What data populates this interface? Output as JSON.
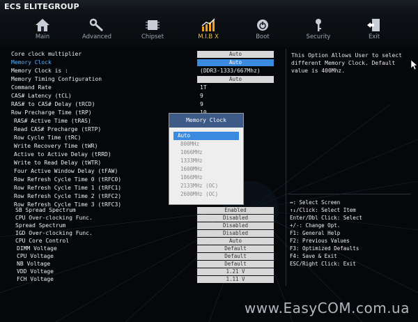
{
  "brand": {
    "logo_text": "ECS ELITEGROUP"
  },
  "tabs": [
    {
      "label": "Main",
      "icon": "home-icon",
      "active": false
    },
    {
      "label": "Advanced",
      "icon": "wrench-icon",
      "active": false
    },
    {
      "label": "Chipset",
      "icon": "chip-icon",
      "active": false
    },
    {
      "label": "M.I.B X",
      "icon": "chart-icon",
      "active": true
    },
    {
      "label": "Boot",
      "icon": "power-icon",
      "active": false
    },
    {
      "label": "Security",
      "icon": "key-icon",
      "active": false
    },
    {
      "label": "Exit",
      "icon": "exit-door-icon",
      "active": false
    }
  ],
  "settings": [
    {
      "label": "Core clock multiplier",
      "value": "Auto",
      "kind": "box"
    },
    {
      "label": "Memory Clock",
      "value": "Auto",
      "kind": "box-active",
      "selected": true
    },
    {
      "label": "Memory Clock is :",
      "value": "(DDR3-1333/667Mhz)",
      "kind": "text"
    },
    {
      "label": "Memory Timing Configuration",
      "value": "Auto",
      "kind": "box"
    },
    {
      "label": "Command Rate",
      "value": "1T",
      "kind": "text"
    },
    {
      "label": "CAS# Latency (tCL)",
      "value": "9",
      "kind": "text"
    },
    {
      "label": "RAS# to CAS# Delay (tRCD)",
      "value": "9",
      "kind": "text"
    },
    {
      "label": "Row Precharge Time (tRP)",
      "value": "10",
      "kind": "text"
    },
    {
      "label": "RAS# Active Time (tRAS)",
      "value": "",
      "kind": "text"
    },
    {
      "label": "Read CAS# Precharge (tRTP)",
      "value": "",
      "kind": "text"
    },
    {
      "label": "Row Cycle Time (tRC)",
      "value": "",
      "kind": "text"
    },
    {
      "label": "Write Recovery Time (tWR)",
      "value": "",
      "kind": "text"
    },
    {
      "label": "Active to Active Delay (tRRD)",
      "value": "",
      "kind": "text"
    },
    {
      "label": "Write to Read Delay (tWTR)",
      "value": "",
      "kind": "text"
    },
    {
      "label": "Four Active Window Delay (tFAW)",
      "value": "",
      "kind": "text"
    },
    {
      "label": "Row Refresh Cycle Time 0 (tRFC0)",
      "value": "",
      "kind": "text"
    },
    {
      "label": "Row Refresh Cycle Time 1 (tRFC1)",
      "value": "",
      "kind": "text"
    },
    {
      "label": "Row Refresh Cycle Time 2 (tRFC2)",
      "value": "",
      "kind": "text"
    },
    {
      "label": "Row Refresh Cycle Time 3 (tRFC3)",
      "value": "",
      "kind": "text"
    },
    {
      "label": "SB Spread Spectrum",
      "value": "Enabled",
      "kind": "box"
    },
    {
      "label": "CPU Over-clocking Func.",
      "value": "Disabled",
      "kind": "box"
    },
    {
      "label": "Spread Spectrum",
      "value": "Disabled",
      "kind": "box"
    },
    {
      "label": "IGD Over-clocking Func.",
      "value": "Disabled",
      "kind": "box"
    },
    {
      "label": "CPU Core Control",
      "value": "Auto",
      "kind": "box"
    },
    {
      "label": "DIMM Voltage",
      "value": "Default",
      "kind": "box"
    },
    {
      "label": "CPU Voltage",
      "value": "Default",
      "kind": "box"
    },
    {
      "label": "NB Voltage",
      "value": "Default",
      "kind": "box"
    },
    {
      "label": "VDD Voltage",
      "value": "1.21 V",
      "kind": "box"
    },
    {
      "label": "FCH Voltage",
      "value": "1.11 V",
      "kind": "box"
    }
  ],
  "help_text": "This Option Allows User to select different Memory Clock. Default value is 400Mhz.",
  "key_help": [
    "↔: Select Screen",
    "↑↓/Click: Select Item",
    "Enter/Dbl Click: Select",
    "+/-: Change Opt.",
    "F1: General Help",
    "F2: Previous Values",
    "F3: Optimized Defaults",
    "F4: Save & Exit",
    "ESC/Right Click: Exit"
  ],
  "popup": {
    "title": "Memory Clock",
    "options": [
      "Auto",
      "800MHz",
      "1066MHz",
      "1333MHz",
      "1600MHz",
      "1866MHz",
      "2133MHz (OC)",
      "2600MHz (OC)"
    ],
    "selected": "Auto"
  },
  "watermark": "www.EasyCOM.com.ua",
  "colors": {
    "accent": "#3a8be0",
    "active_tab": "#f0c040",
    "selected_label": "#58b4ff"
  }
}
